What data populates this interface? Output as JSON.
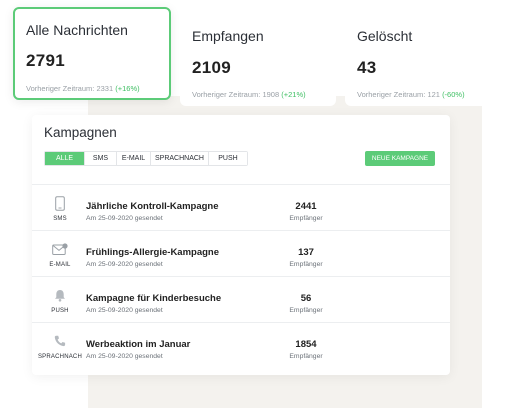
{
  "stats": [
    {
      "title": "Alle Nachrichten",
      "value": "2791",
      "prev_label": "Vorheriger Zeitraum: 2331",
      "delta": "(+16%)"
    },
    {
      "title": "Empfangen",
      "value": "2109",
      "prev_label": "Vorheriger Zeitraum: 1908",
      "delta": "(+21%)"
    },
    {
      "title": "Gelöscht",
      "value": "43",
      "prev_label": "Vorheriger Zeitraum: 121",
      "delta": "(-60%)"
    }
  ],
  "campaigns": {
    "title": "Kampagnen",
    "filters": [
      "ALLE",
      "SMS",
      "E-MAIL",
      "SPRACHNACH",
      "PUSH"
    ],
    "active_filter": "ALLE",
    "new_button": "NEUE KAMPAGNE",
    "rows": [
      {
        "icon": "phone-icon",
        "type": "SMS",
        "name": "Jährliche Kontroll-Kampagne",
        "date": "Am 25-09-2020 gesendet",
        "count": "2441",
        "count_label": "Empfänger"
      },
      {
        "icon": "envelope-icon",
        "type": "E-MAIL",
        "name": "Frühlings-Allergie-Kampagne",
        "date": "Am 25-09-2020 gesendet",
        "count": "137",
        "count_label": "Empfänger"
      },
      {
        "icon": "bell-icon",
        "type": "PUSH",
        "name": "Kampagne für Kinderbesuche",
        "date": "Am 25-09-2020 gesendet",
        "count": "56",
        "count_label": "Empfänger"
      },
      {
        "icon": "telephone-handset-icon",
        "type": "SPRACHNACH",
        "name": "Werbeaktion im Januar",
        "date": "Am 25-09-2020 gesendet",
        "count": "1854",
        "count_label": "Empfänger"
      }
    ]
  },
  "colors": {
    "accent": "#5ccb78",
    "positive": "#3fbf63",
    "panel_bg": "#f4f2ee"
  }
}
